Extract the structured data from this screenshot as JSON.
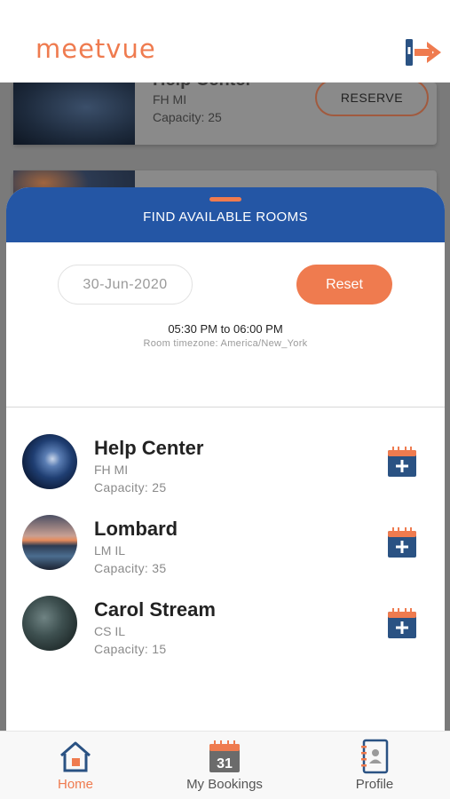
{
  "app": {
    "logo": "meetvue"
  },
  "background": {
    "card1": {
      "title": "Help Center",
      "code": "FH MI",
      "capacity": "Capacity: 25",
      "reserve_label": "RESERVE"
    }
  },
  "sheet": {
    "title": "FIND AVAILABLE ROOMS",
    "date_value": "30-Jun-2020",
    "reset_label": "Reset",
    "time_range": "05:30 PM to 06:00 PM",
    "timezone": "Room timezone: America/New_York"
  },
  "rooms": [
    {
      "name": "Help Center",
      "code": "FH MI",
      "capacity": "Capacity: 25"
    },
    {
      "name": "Lombard",
      "code": "LM IL",
      "capacity": "Capacity: 35"
    },
    {
      "name": "Carol Stream",
      "code": "CS IL",
      "capacity": "Capacity: 15"
    }
  ],
  "tabs": [
    {
      "label": "Home",
      "icon": "home-icon",
      "active": true
    },
    {
      "label": "My Bookings",
      "icon": "calendar-icon",
      "calendar_day": "31",
      "active": false
    },
    {
      "label": "Profile",
      "icon": "profile-book-icon",
      "active": false
    }
  ],
  "colors": {
    "accent": "#ef7b4f",
    "primary": "#2456a5",
    "icon_navy": "#2a5283"
  }
}
